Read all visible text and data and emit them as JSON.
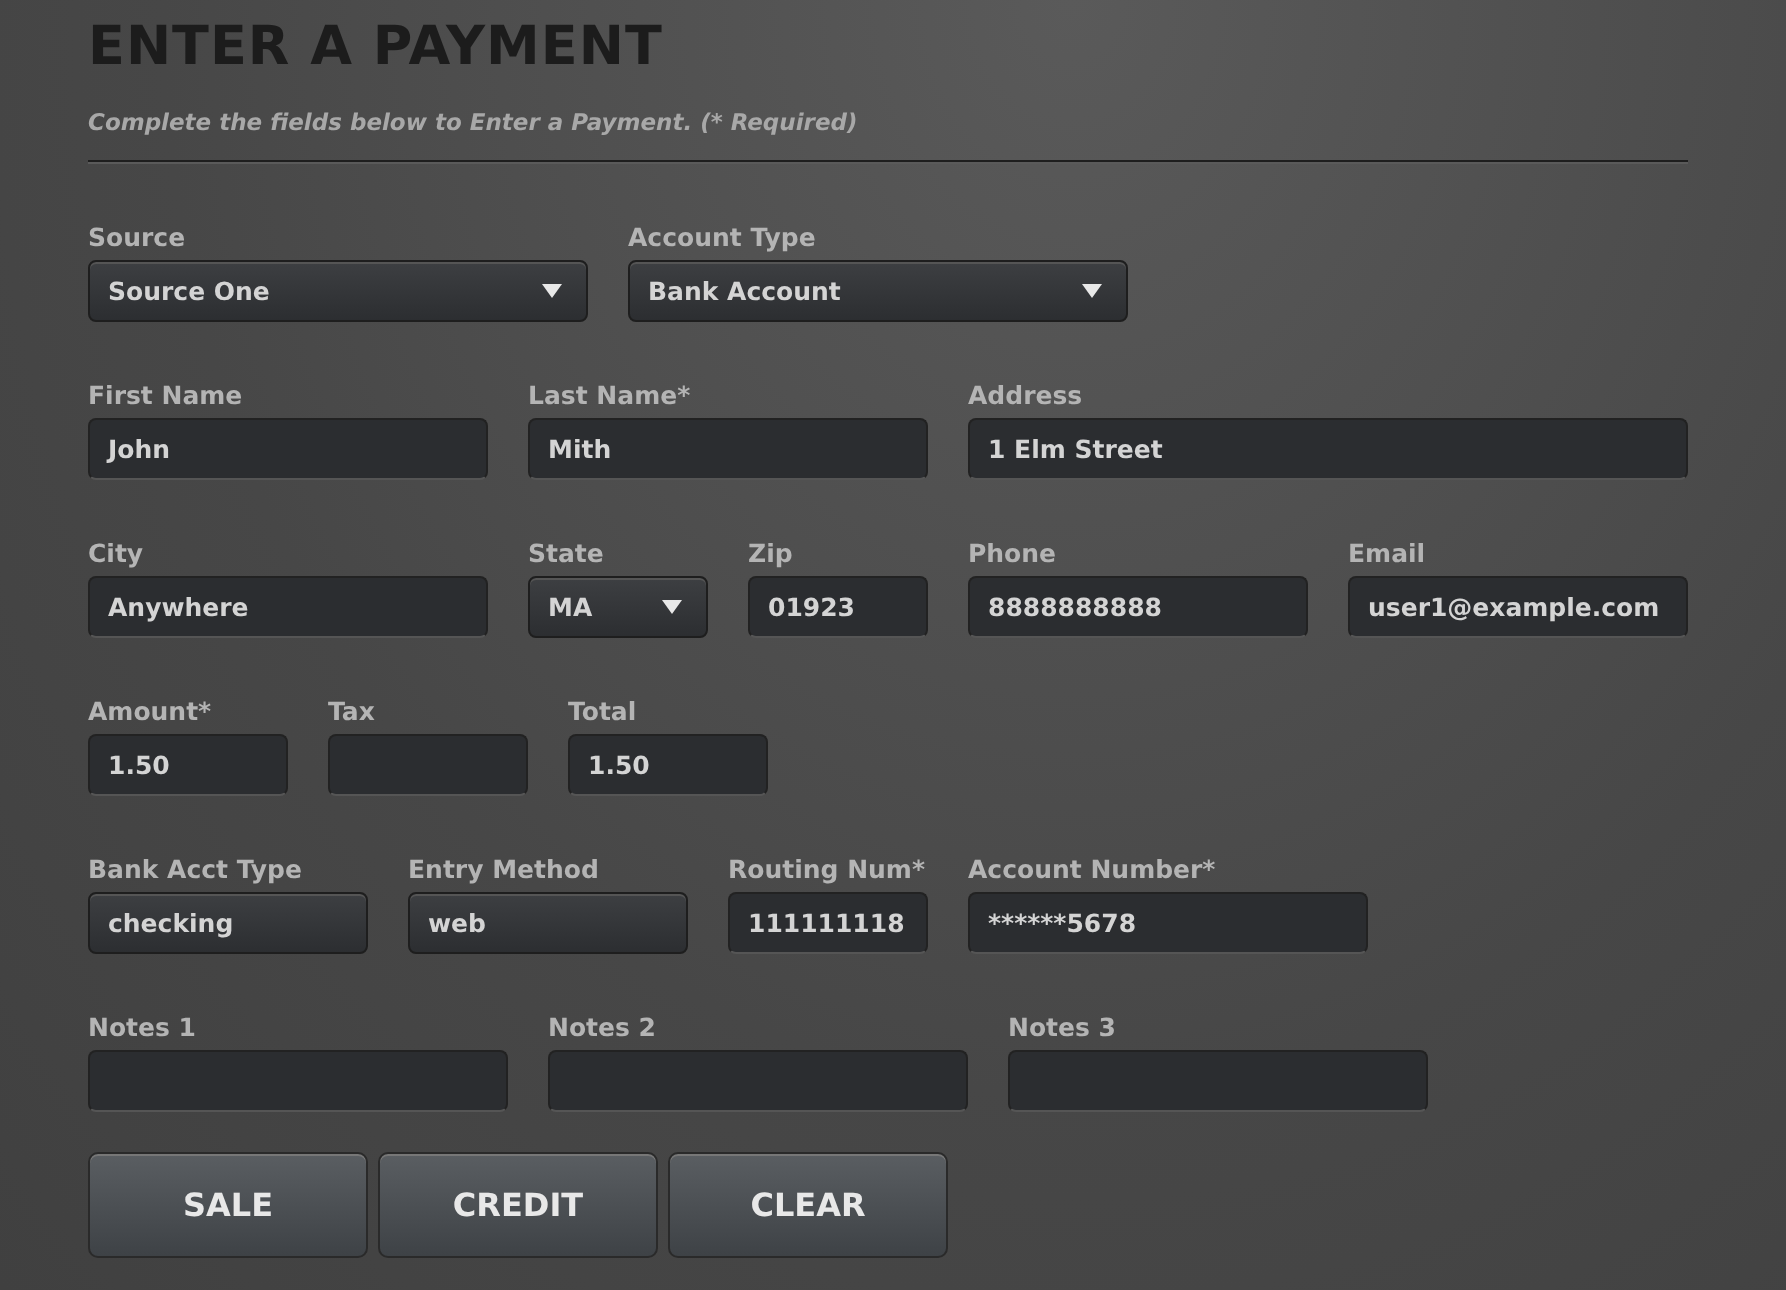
{
  "title": "ENTER A PAYMENT",
  "subtitle": "Complete the fields below to Enter a Payment. (* Required)",
  "rows": [
    {
      "fields": [
        {
          "label": "Source",
          "kind": "select",
          "value": "Source One"
        },
        {
          "label": "Account Type",
          "kind": "select",
          "value": "Bank Account"
        }
      ]
    },
    {
      "fields": [
        {
          "label": "First Name",
          "kind": "text",
          "value": "John"
        },
        {
          "label": "Last Name*",
          "kind": "text",
          "value": "Mith"
        },
        {
          "label": "Address",
          "kind": "text",
          "value": "1 Elm Street"
        }
      ]
    },
    {
      "fields": [
        {
          "label": "City",
          "kind": "text",
          "value": "Anywhere"
        },
        {
          "label": "State",
          "kind": "select",
          "value": "MA"
        },
        {
          "label": "Zip",
          "kind": "text",
          "value": "01923"
        },
        {
          "label": "Phone",
          "kind": "text",
          "value": "8888888888"
        },
        {
          "label": "Email",
          "kind": "text",
          "value": "user1@example.com"
        }
      ]
    },
    {
      "fields": [
        {
          "label": "Amount*",
          "kind": "text",
          "value": "1.50"
        },
        {
          "label": "Tax",
          "kind": "text"
        },
        {
          "label": "Total",
          "kind": "text",
          "value": "1.50"
        }
      ]
    },
    {
      "fields": [
        {
          "label": "Bank Acct Type",
          "kind": "readonly",
          "value": "checking"
        },
        {
          "label": "Entry Method",
          "kind": "readonly",
          "value": "web"
        },
        {
          "label": "Routing Num*",
          "kind": "text",
          "value": "111111118"
        },
        {
          "label": "Account Number*",
          "kind": "text",
          "value": "******5678"
        }
      ]
    },
    {
      "fields": [
        {
          "label": "Notes 1",
          "kind": "text"
        },
        {
          "label": "Notes 2",
          "kind": "text"
        },
        {
          "label": "Notes 3",
          "kind": "text"
        }
      ]
    }
  ],
  "buttons": [
    "SALE",
    "CREDIT",
    "CLEAR"
  ]
}
